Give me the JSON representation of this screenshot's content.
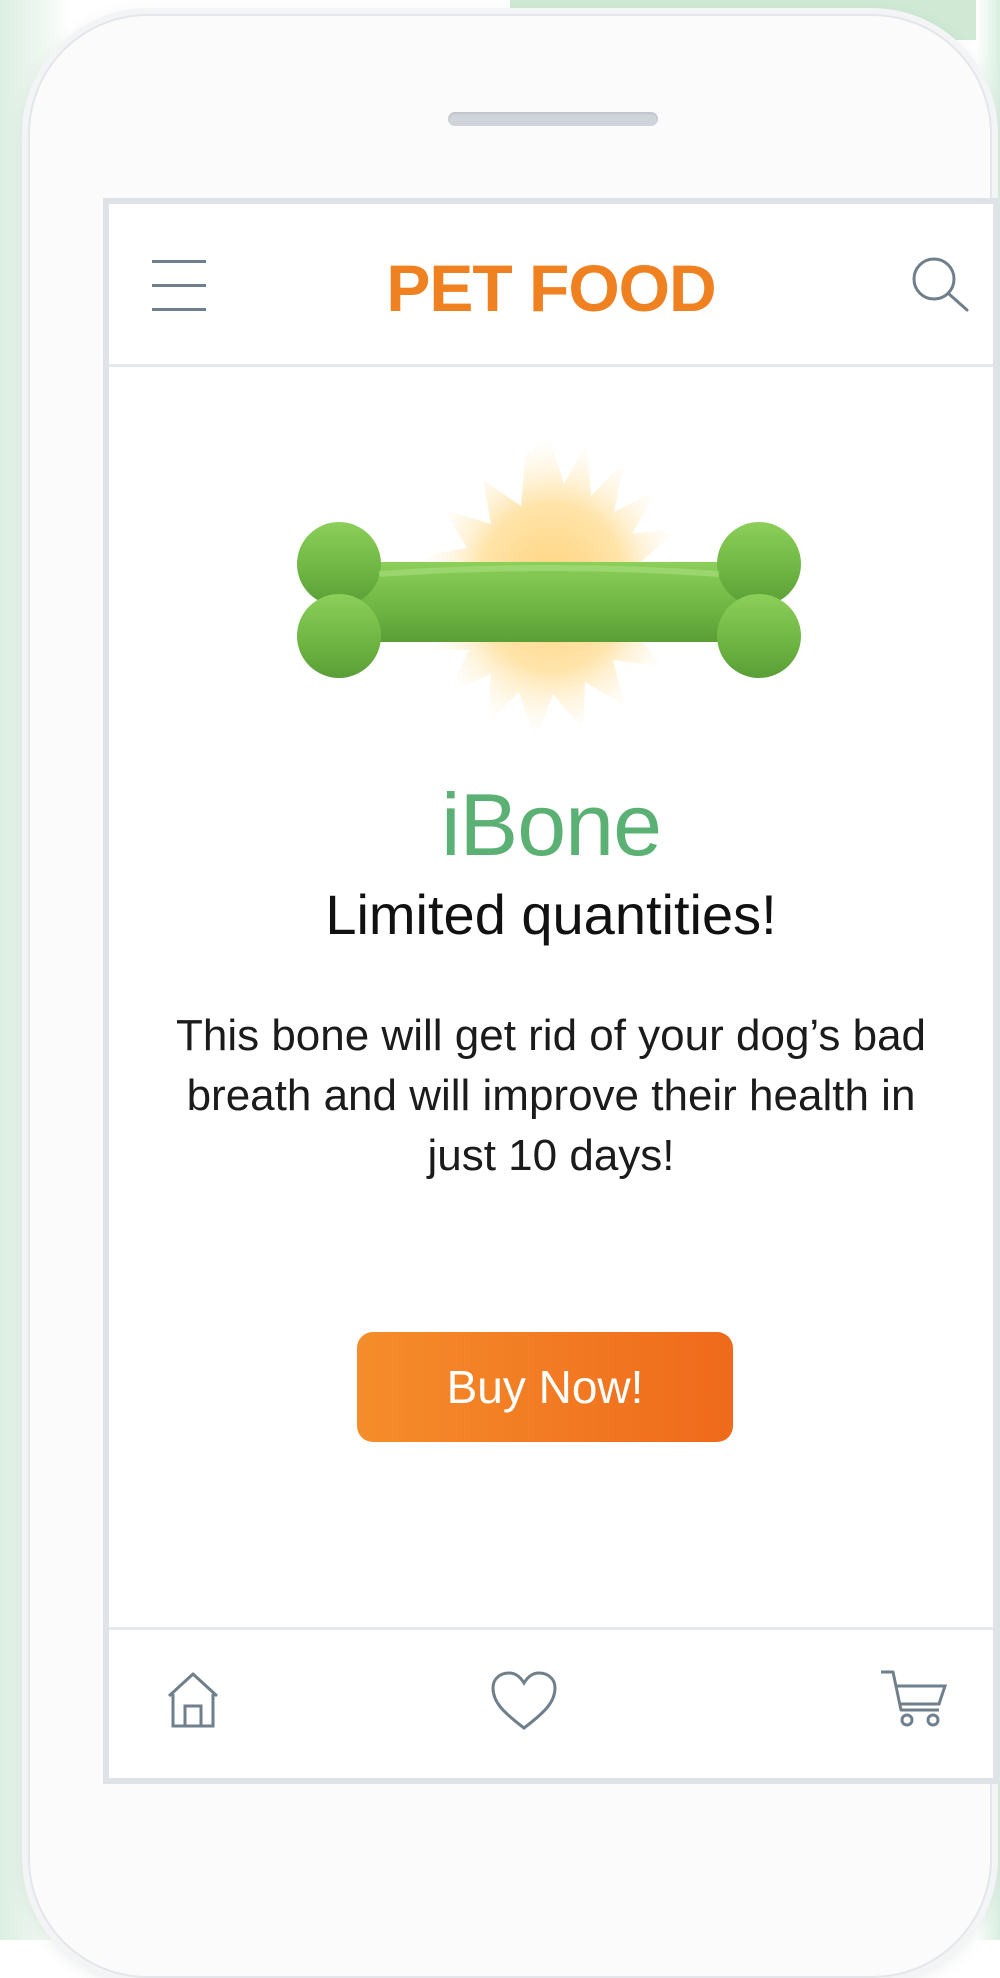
{
  "header": {
    "brand": "PET FOOD",
    "menu_icon": "hamburger-menu-icon",
    "search_icon": "search-icon"
  },
  "product": {
    "image": "green-bone-with-sunburst",
    "name": "iBone",
    "tagline": "Limited quantities!",
    "description": "This bone will get rid of your dog’s bad breath and will improve their health in just 10 days!",
    "cta_label": "Buy Now!"
  },
  "footer": {
    "nav": [
      {
        "icon": "home-icon"
      },
      {
        "icon": "heart-icon"
      },
      {
        "icon": "cart-icon"
      }
    ]
  },
  "colors": {
    "brand_orange": "#f08121",
    "product_green": "#5bb174",
    "icon_gray": "#6f7f8c"
  }
}
